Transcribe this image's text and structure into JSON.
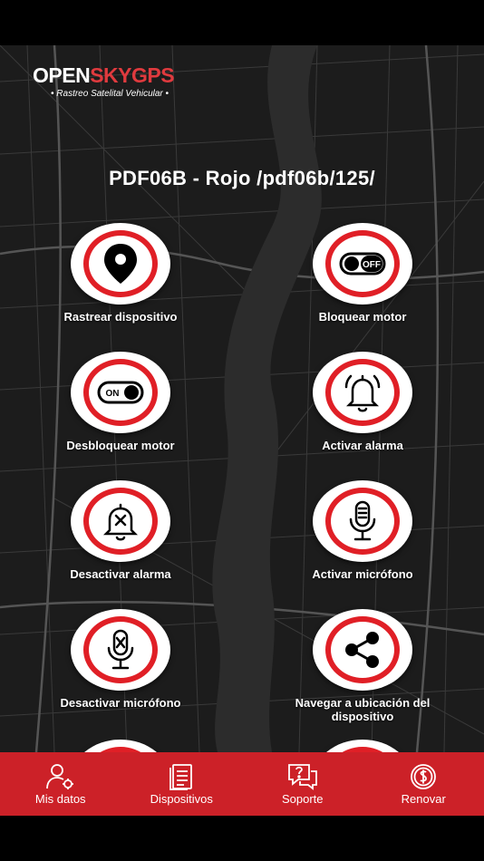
{
  "brand": {
    "name_part1": "OPEN",
    "name_part2": "SKY",
    "name_part3": "GPS",
    "tagline": "• Rastreo Satelital Vehicular •"
  },
  "device_title": "PDF06B - Rojo /pdf06b/125/",
  "actions": [
    {
      "label": "Rastrear dispositivo",
      "icon": "location-pin-icon"
    },
    {
      "label": "Bloquear motor",
      "icon": "toggle-off-icon"
    },
    {
      "label": "Desbloquear motor",
      "icon": "toggle-on-icon"
    },
    {
      "label": "Activar alarma",
      "icon": "bell-ringing-icon"
    },
    {
      "label": "Desactivar alarma",
      "icon": "bell-off-icon"
    },
    {
      "label": "Activar micrófono",
      "icon": "microphone-icon"
    },
    {
      "label": "Desactivar micrófono",
      "icon": "microphone-off-icon"
    },
    {
      "label": "Navegar a ubicación del dispositivo",
      "icon": "share-icon"
    }
  ],
  "toggle": {
    "off_text": "OFF",
    "on_text": "ON"
  },
  "nav": [
    {
      "label": "Mis datos",
      "icon": "user-settings-icon"
    },
    {
      "label": "Dispositivos",
      "icon": "document-list-icon"
    },
    {
      "label": "Soporte",
      "icon": "help-chat-icon"
    },
    {
      "label": "Renovar",
      "icon": "dollar-coin-icon"
    }
  ],
  "colors": {
    "accent_red": "#e01f26",
    "nav_red": "#cc2128",
    "map_bg": "#1b1b1b"
  }
}
